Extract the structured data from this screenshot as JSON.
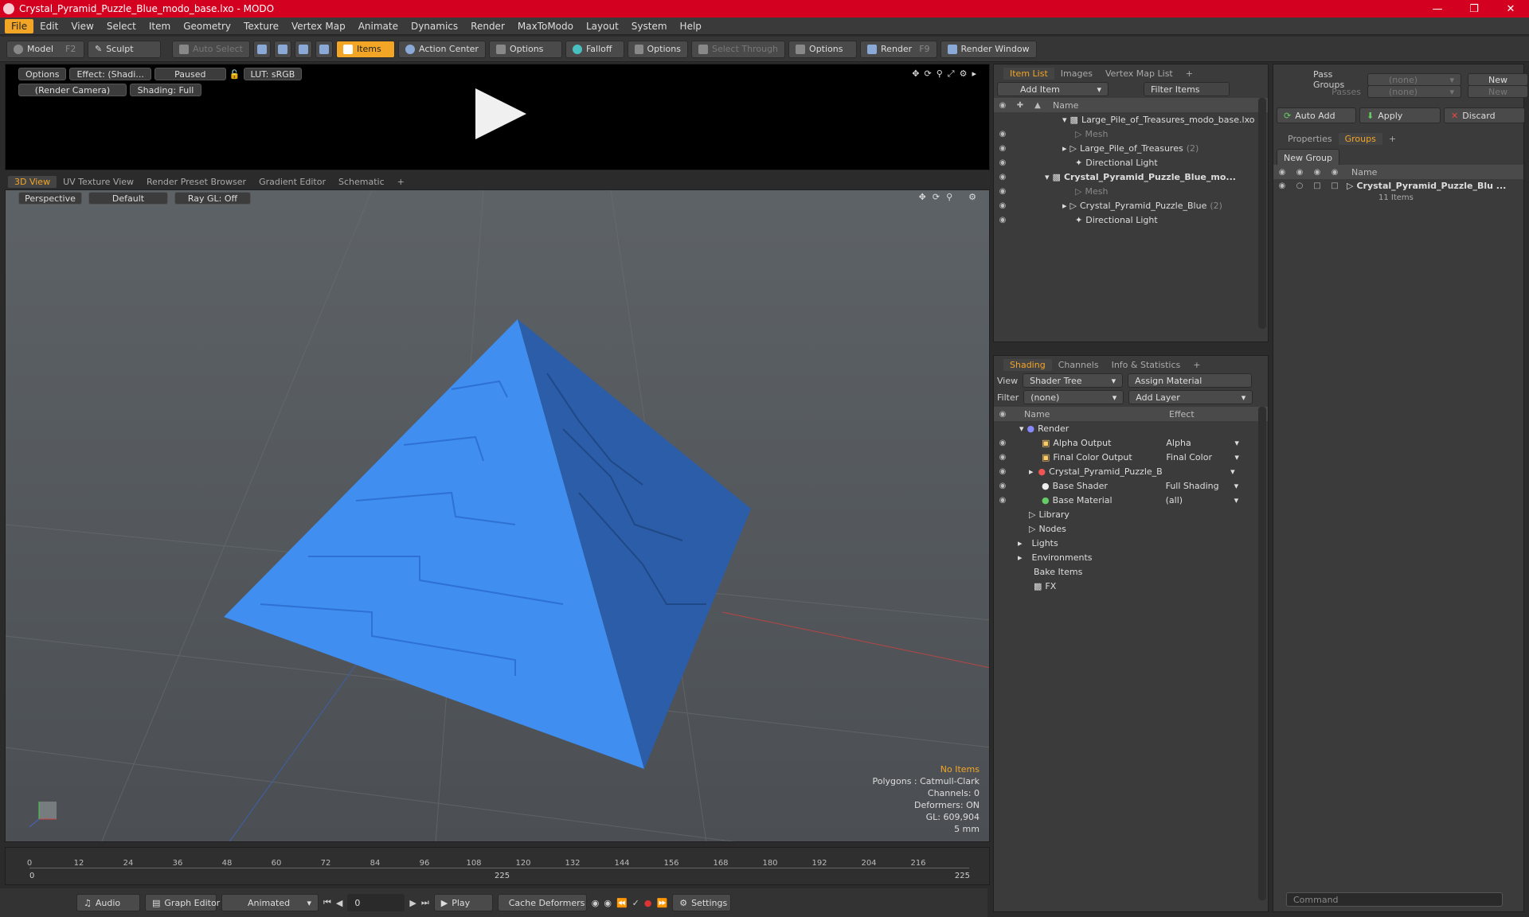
{
  "window": {
    "title": "Crystal_Pyramid_Puzzle_Blue_modo_base.lxo - MODO"
  },
  "menu": [
    "File",
    "Edit",
    "View",
    "Select",
    "Item",
    "Geometry",
    "Texture",
    "Vertex Map",
    "Animate",
    "Dynamics",
    "Render",
    "MaxToModo",
    "Layout",
    "System",
    "Help"
  ],
  "toolbar": {
    "model": "Model",
    "model_key": "F2",
    "sculpt": "Sculpt",
    "auto_select": "Auto Select",
    "items": "Items",
    "action_center": "Action Center",
    "options1": "Options",
    "falloff": "Falloff",
    "options2": "Options",
    "select_through": "Select Through",
    "options3": "Options",
    "render": "Render",
    "render_key": "F9",
    "render_window": "Render Window"
  },
  "render_view": {
    "options": "Options",
    "effect": "Effect: (Shadi...",
    "paused": "Paused",
    "lut": "LUT: sRGB",
    "camera": "(Render Camera)",
    "shading": "Shading: Full"
  },
  "view_tabs": [
    "3D View",
    "UV Texture View",
    "Render Preset Browser",
    "Gradient Editor",
    "Schematic"
  ],
  "viewport": {
    "perspective": "Perspective",
    "default": "Default",
    "raygl": "Ray GL: Off",
    "stats": {
      "no_items": "No Items",
      "polygons": "Polygons : Catmull-Clark",
      "channels": "Channels: 0",
      "deformers": "Deformers: ON",
      "gl": "GL: 609,904",
      "unit": "5 mm"
    }
  },
  "timeline": {
    "ticks": [
      "0",
      "12",
      "24",
      "36",
      "48",
      "60",
      "72",
      "84",
      "96",
      "108",
      "120",
      "132",
      "144",
      "156",
      "168",
      "180",
      "192",
      "204",
      "216"
    ],
    "start": "0",
    "mid": "225",
    "end": "225"
  },
  "bottom": {
    "audio": "Audio",
    "graph_editor": "Graph Editor",
    "animated": "Animated",
    "frame": "0",
    "play": "Play",
    "cache": "Cache Deformers",
    "settings": "Settings"
  },
  "item_list": {
    "tabs": [
      "Item List",
      "Images",
      "Vertex Map List"
    ],
    "add_item": "Add Item",
    "filter": "Filter Items",
    "col_name": "Name",
    "rows": [
      {
        "label": "Large_Pile_of_Treasures_modo_base.lxo",
        "indent": 0,
        "bold": false
      },
      {
        "label": "Mesh",
        "indent": 1,
        "dim": true
      },
      {
        "label": "Large_Pile_of_Treasures",
        "count": "(2)",
        "indent": 1
      },
      {
        "label": "Directional Light",
        "indent": 1
      },
      {
        "label": "Crystal_Pyramid_Puzzle_Blue_mo...",
        "indent": 0,
        "bold": true
      },
      {
        "label": "Mesh",
        "indent": 1,
        "dim": true
      },
      {
        "label": "Crystal_Pyramid_Puzzle_Blue",
        "count": "(2)",
        "indent": 1
      },
      {
        "label": "Directional Light",
        "indent": 1
      }
    ]
  },
  "shading": {
    "tabs": [
      "Shading",
      "Channels",
      "Info & Statistics"
    ],
    "view_label": "View",
    "view_value": "Shader Tree",
    "assign": "Assign Material",
    "filter_label": "Filter",
    "filter_value": "(none)",
    "add_layer": "Add Layer",
    "col_name": "Name",
    "col_effect": "Effect",
    "rows": [
      {
        "label": "Render",
        "effect": ""
      },
      {
        "label": "Alpha Output",
        "effect": "Alpha"
      },
      {
        "label": "Final Color Output",
        "effect": "Final Color"
      },
      {
        "label": "Crystal_Pyramid_Puzzle_Bl...",
        "effect": ""
      },
      {
        "label": "Base Shader",
        "effect": "Full Shading"
      },
      {
        "label": "Base Material",
        "effect": "(all)"
      },
      {
        "label": "Library",
        "effect": ""
      },
      {
        "label": "Nodes",
        "effect": ""
      },
      {
        "label": "Lights",
        "effect": ""
      },
      {
        "label": "Environments",
        "effect": ""
      },
      {
        "label": "Bake Items",
        "effect": ""
      },
      {
        "label": "FX",
        "effect": ""
      }
    ]
  },
  "groups": {
    "pass_groups": "Pass Groups",
    "passes": "Passes",
    "none": "(none)",
    "new": "New",
    "auto_add": "Auto Add",
    "apply": "Apply",
    "discard": "Discard",
    "tabs": [
      "Properties",
      "Groups"
    ],
    "new_group": "New Group",
    "col_name": "Name",
    "group_name": "Crystal_Pyramid_Puzzle_Blu ...",
    "group_items": "11 Items"
  },
  "command": {
    "placeholder": "Command"
  }
}
